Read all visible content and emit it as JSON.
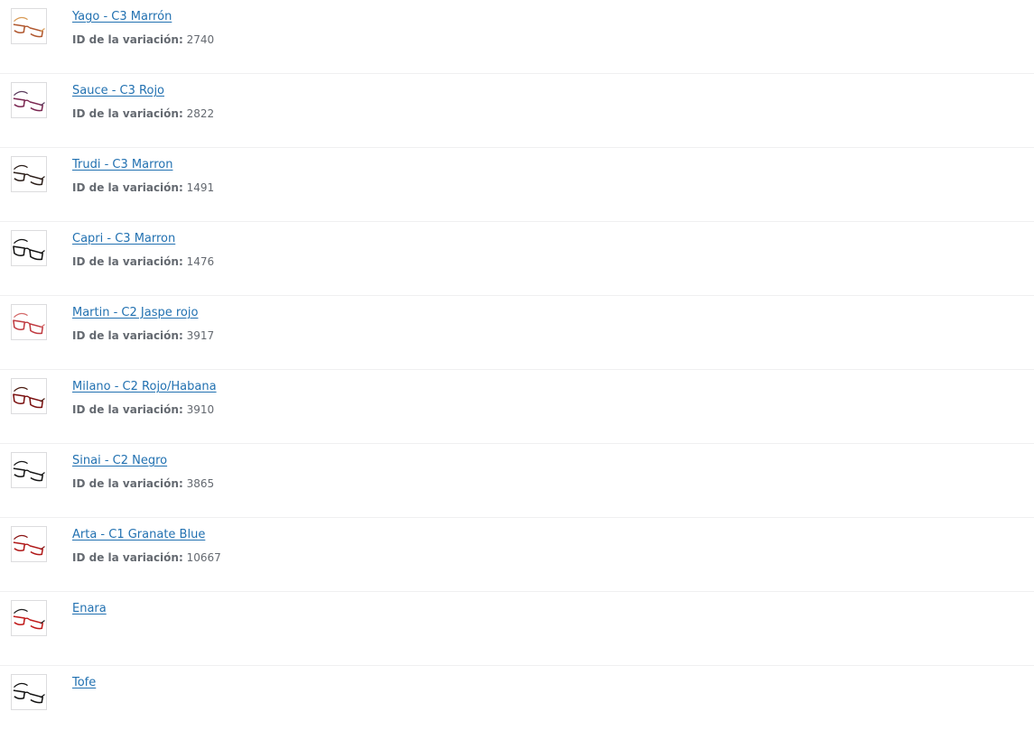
{
  "items": [
    {
      "name": "Yago - C3 Marrón",
      "variation_label": "ID de la variación:",
      "variation_id": "2740",
      "frame_color": "#b0572e",
      "temple_color": "#d89a55",
      "style": "half"
    },
    {
      "name": "Sauce - C3 Rojo",
      "variation_label": "ID de la variación:",
      "variation_id": "2822",
      "frame_color": "#7a2650",
      "temple_color": "#5a3b5c",
      "style": "half"
    },
    {
      "name": "Trudi - C3 Marron",
      "variation_label": "ID de la variación:",
      "variation_id": "1491",
      "frame_color": "#2a1d18",
      "temple_color": "#2a1d18",
      "style": "half"
    },
    {
      "name": "Capri - C3 Marron",
      "variation_label": "ID de la variación:",
      "variation_id": "1476",
      "frame_color": "#111111",
      "temple_color": "#111111",
      "style": "full"
    },
    {
      "name": "Martin - C2 Jaspe rojo",
      "variation_label": "ID de la variación:",
      "variation_id": "3917",
      "frame_color": "#c03a40",
      "temple_color": "#d46a6a",
      "style": "full"
    },
    {
      "name": "Milano - C2 Rojo/Habana",
      "variation_label": "ID de la variación:",
      "variation_id": "3910",
      "frame_color": "#7a1010",
      "temple_color": "#4a1a10",
      "style": "full"
    },
    {
      "name": "Sinai - C2 Negro",
      "variation_label": "ID de la variación:",
      "variation_id": "3865",
      "frame_color": "#151515",
      "temple_color": "#151515",
      "style": "half"
    },
    {
      "name": "Arta - C1 Granate Blue",
      "variation_label": "ID de la variación:",
      "variation_id": "10667",
      "frame_color": "#b01818",
      "temple_color": "#8a1414",
      "style": "half"
    },
    {
      "name": "Enara",
      "frame_color": "#c01818",
      "temple_color": "#222222",
      "style": "half"
    },
    {
      "name": "Tofe",
      "frame_color": "#111111",
      "temple_color": "#111111",
      "style": "half"
    }
  ]
}
